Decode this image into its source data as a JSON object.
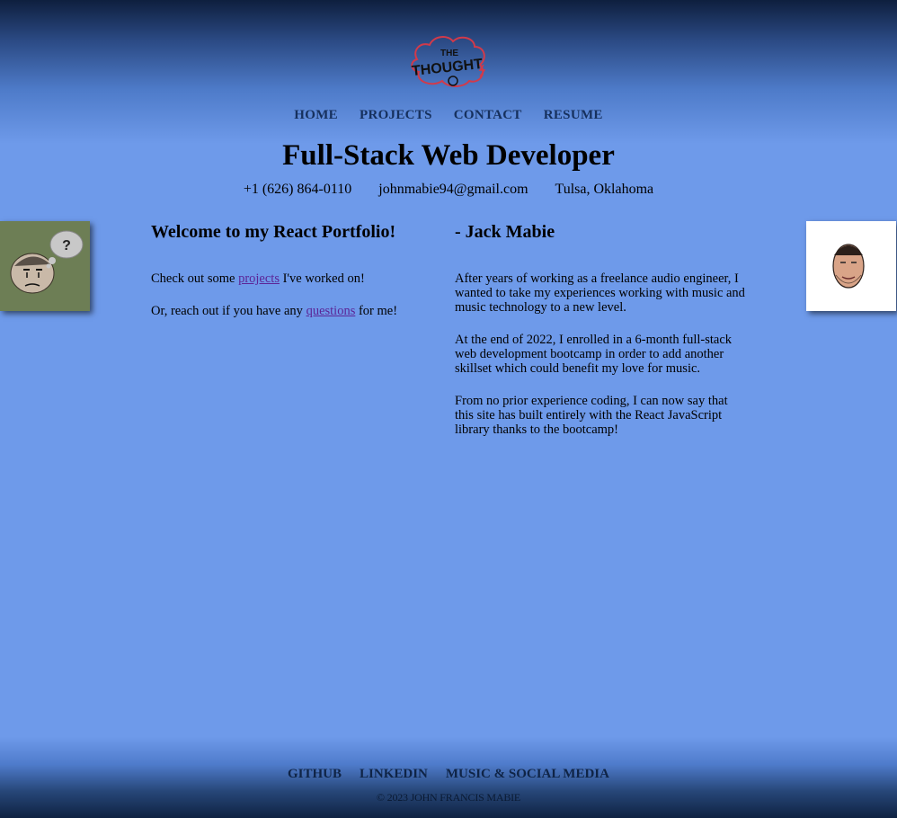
{
  "header": {
    "logo": {
      "text_top": "THE",
      "text_main": "THOUGHT",
      "icon": "thought-cloud-logo"
    },
    "nav": [
      {
        "label": "HOME"
      },
      {
        "label": "PROJECTS"
      },
      {
        "label": "CONTACT"
      },
      {
        "label": "RESUME"
      }
    ]
  },
  "hero": {
    "title": "Full-Stack Web Developer",
    "phone": "+1 (626) 864-0110",
    "email": "johnmabie94@gmail.com",
    "location": "Tulsa, Oklahoma"
  },
  "side_images": {
    "left": {
      "icon": "thinking-face-cartoon",
      "badge": "?"
    },
    "right": {
      "icon": "profile-face-cartoon"
    }
  },
  "left_column": {
    "heading": "Welcome to my React Portfolio!",
    "p1_before": "Check out some ",
    "p1_link": "projects",
    "p1_after": " I've worked on!",
    "p2_before": "Or, reach out if you have any ",
    "p2_link": "questions",
    "p2_after": " for me!"
  },
  "right_column": {
    "heading": "- Jack Mabie",
    "paragraphs": [
      "After years of working as a freelance audio engineer, I wanted to take my experiences working with music and music technology to a new level.",
      "At the end of 2022, I enrolled in a 6-month full-stack web development bootcamp in order to add another skillset which could benefit my love for music.",
      "From no prior experience coding, I can now say that this site has built entirely with the React JavaScript library thanks to the bootcamp!"
    ]
  },
  "footer": {
    "links": [
      {
        "label": "GITHUB"
      },
      {
        "label": "LINKEDIN"
      },
      {
        "label": "MUSIC & SOCIAL MEDIA"
      }
    ],
    "copyright": "© 2023 JOHN FRANCIS MABIE"
  },
  "colors": {
    "background": "#6f9bea",
    "nav_text": "#16305d",
    "link": "#5c2597",
    "logo_cloud": "#d23a4a"
  }
}
